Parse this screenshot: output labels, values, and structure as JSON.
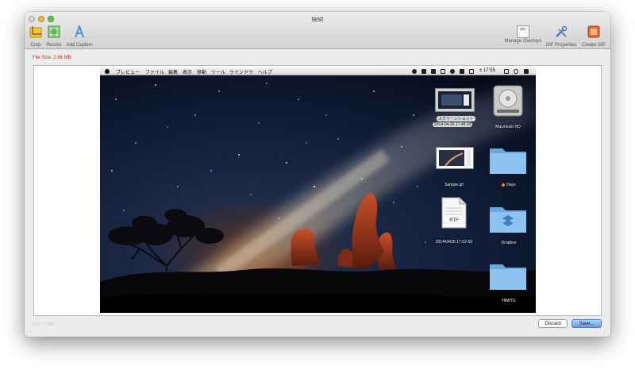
{
  "window": {
    "title": "test"
  },
  "toolbar": {
    "crop_label": "Crop",
    "resize_label": "Resize",
    "add_caption_label": "Add Caption",
    "manage_overlays_label": "Manage Overlays",
    "manage_overlays_icon_text": "abc",
    "gif_properties_label": "GIF Properties",
    "create_gif_label": "Create GIF"
  },
  "content": {
    "file_size": "File Size: 2.66 MB",
    "dimension": "512 × 288",
    "discard_label": "Discard",
    "save_label": "Save..."
  },
  "preview": {
    "menu": [
      "プレビュー",
      "ファイル",
      "編集",
      "表示",
      "移動",
      "ツール",
      "ウインドウ",
      "ヘルプ"
    ],
    "clock": "± 17:55",
    "icons": {
      "screenshot_label": "スクリーンショット",
      "screenshot_date": "2014-04-26 17.48.33",
      "macintosh_hd": "Macintosh HD",
      "sample_gif": "Sample.gif",
      "days": "Days",
      "rtf_text": "RTF",
      "rtf_file": "2014/04/26 17-52-50",
      "dropbox": "Dropbox",
      "himitu": "HIMITU"
    }
  },
  "colors": {
    "file_size_text": "#e02020",
    "save_button": "#5b9ce6",
    "folder_blue": "#7fb8e6",
    "menubar": "#e6e6e6"
  }
}
